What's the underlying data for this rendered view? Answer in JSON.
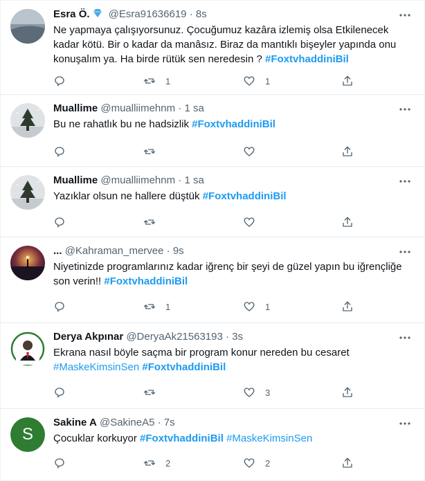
{
  "tweets": [
    {
      "name": "Esra Ö.",
      "handle": "@Esra91636619",
      "dot": "·",
      "time": "8s",
      "text_parts": [
        "Ne yapmaya çalışıyorsunuz. Çocuğumuz kazâra izlemiş olsa Etkilenecek kadar kötü. Bir o kadar da manâsız. Biraz da mantıklı bişeyler yapında onu konuşalım ya. Ha birde rütük sen neredesin ? "
      ],
      "hashtags": [
        "#FoxtvhaddiniBil"
      ],
      "retweets": "1",
      "likes": "1"
    },
    {
      "name": "Muallime",
      "handle": "@mualliimehnm",
      "dot": "·",
      "time": "1 sa",
      "text_parts": [
        "Bu ne rahatlık bu ne hadsizlik "
      ],
      "hashtags": [
        "#FoxtvhaddiniBil"
      ],
      "retweets": "",
      "likes": ""
    },
    {
      "name": "Muallime",
      "handle": "@mualliimehnm",
      "dot": "·",
      "time": "1 sa",
      "text_parts": [
        "Yazıklar olsun ne hallere düştük "
      ],
      "hashtags": [
        "#FoxtvhaddiniBil"
      ],
      "retweets": "",
      "likes": ""
    },
    {
      "name": "...",
      "handle": "@Kahraman_mervee",
      "dot": "·",
      "time": "9s",
      "text_parts": [
        "Niyetinizde programlarınız kadar iğrenç bir şeyi de güzel yapın bu iğrençliğe son verin!! "
      ],
      "hashtags": [
        "#FoxtvhaddiniBil"
      ],
      "retweets": "1",
      "likes": "1"
    },
    {
      "name": "Derya Akpınar",
      "handle": "@DeryaAk21563193",
      "dot": "·",
      "time": "3s",
      "text_parts": [
        "Ekrana nasıl  böyle saçma bir program konur nereden bu cesaret "
      ],
      "hashtags": [
        "#MaskeKimsinSen",
        "#FoxtvhaddiniBil"
      ],
      "retweets": "",
      "likes": "3"
    },
    {
      "name": "Sakine A",
      "handle": "@SakineA5",
      "dot": "·",
      "time": "7s",
      "avatar_letter": "S",
      "text_parts": [
        "Çocuklar korkuyor "
      ],
      "hashtags": [
        "#FoxtvhaddiniBil",
        "#MaskeKimsinSen"
      ],
      "retweets": "2",
      "likes": "2"
    }
  ],
  "colors": {
    "accent": "#1d9bf0",
    "muted": "#536471",
    "text": "#0f1419",
    "verified": "#4aa8e8"
  },
  "icons": [
    "reply-icon",
    "retweet-icon",
    "like-icon",
    "share-icon",
    "more-icon",
    "verified-badge-icon"
  ]
}
